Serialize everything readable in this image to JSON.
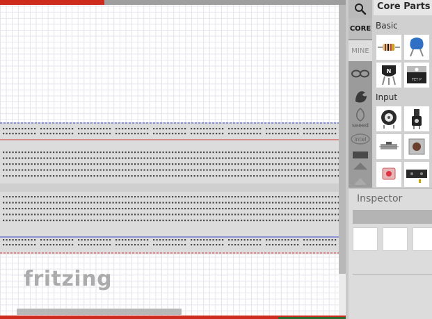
{
  "canvas": {
    "logo_text": "fritzing"
  },
  "parts_bin": {
    "title": "Core Parts",
    "tabs": [
      {
        "label": "CORE",
        "icon": "core-tab",
        "selected": true
      },
      {
        "label": "MINE",
        "icon": "mine-tab",
        "selected": false
      }
    ],
    "bin_icons": [
      "search-icon",
      "arduino-icon",
      "sparkfun-icon",
      "seeed-icon",
      "intel-icon",
      "flag-icon",
      "triangle-icon",
      "partial-icon"
    ],
    "seeed_label": "seeed",
    "intel_label": "intel",
    "sections": [
      {
        "label": "Basic",
        "parts": [
          "resistor",
          "ceramic-capacitor",
          "npn-transistor",
          "fet-transistor"
        ]
      },
      {
        "label": "Input",
        "parts": [
          "rotary-potentiometer",
          "slide-potentiometer",
          "dip-switch",
          "pushbutton",
          "light-sensor",
          "ultrasonic-sensor"
        ]
      }
    ],
    "transistor_label": "N",
    "fet_label": "FET P"
  },
  "inspector": {
    "title": "Inspector"
  },
  "colors": {
    "accent_red": "#cc2b1e",
    "breadboard_blue_rail": "#3b47c4",
    "breadboard_red_rail": "#d23a3a"
  }
}
